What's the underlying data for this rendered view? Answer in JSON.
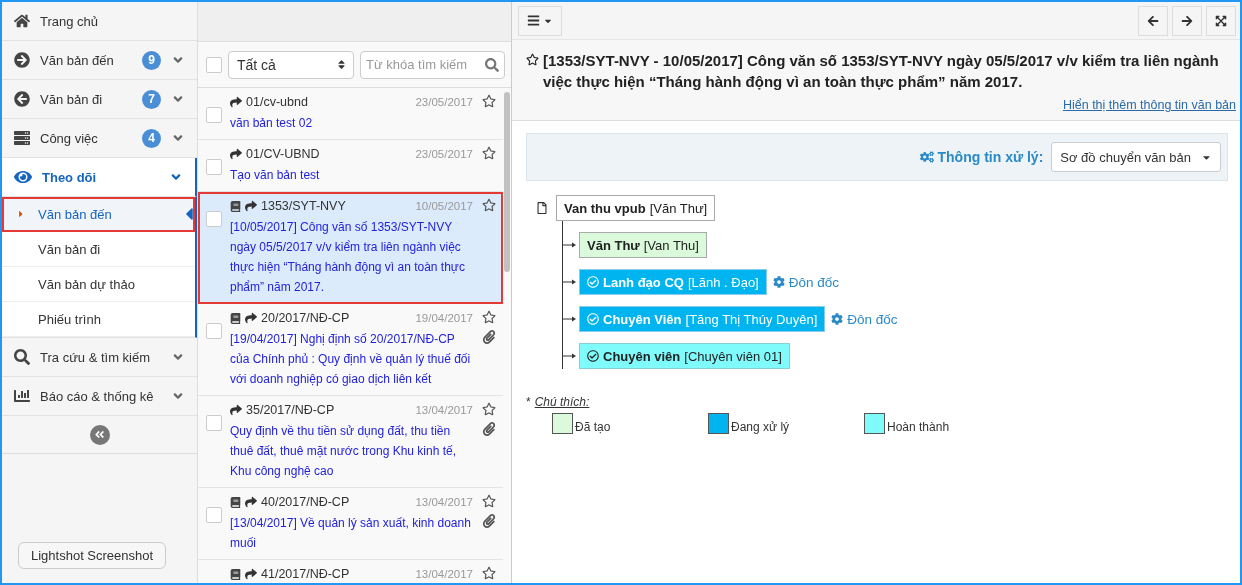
{
  "sidebar": {
    "items": [
      {
        "label": "Trang chủ",
        "submenu": false,
        "selected": false
      },
      {
        "label": "Văn bản đến",
        "badge": "9",
        "submenu": true,
        "selected": false
      },
      {
        "label": "Văn bản đi",
        "badge": "7",
        "submenu": true,
        "selected": false
      },
      {
        "label": "Công việc",
        "badge": "4",
        "submenu": true,
        "selected": false
      },
      {
        "label": "Theo dõi",
        "submenu": true,
        "selected": true,
        "children": [
          {
            "label": "Văn bản đến",
            "selected": true
          },
          {
            "label": "Văn bản đi",
            "selected": false
          },
          {
            "label": "Văn bản dự thảo",
            "selected": false
          },
          {
            "label": "Phiếu trình",
            "selected": false
          }
        ]
      },
      {
        "label": "Tra cứu & tìm kiếm",
        "submenu": true,
        "selected": false
      },
      {
        "label": "Báo cáo & thống kê",
        "submenu": true,
        "selected": false
      }
    ]
  },
  "tooltip": "Lightshot Screenshot",
  "list": {
    "select_all": {
      "checked": false
    },
    "filter": "Tất cả",
    "search": {
      "placeholder": "Từ khóa tìm kiếm"
    },
    "items": [
      {
        "number": "01/cv-ubnd",
        "date": "23/05/2017",
        "summary": "văn bản test 02",
        "book": false,
        "attachment": false,
        "checked": false,
        "selected": false
      },
      {
        "number": "01/CV-UBND",
        "date": "23/05/2017",
        "summary": "Tạo văn bản test",
        "book": false,
        "attachment": false,
        "checked": false,
        "selected": false
      },
      {
        "number": "1353/SYT-NVY",
        "date": "10/05/2017",
        "summary": "[10/05/2017] Công văn số 1353/SYT-NVY ngày 05/5/2017 v/v kiểm tra liên ngành việc thực hiện “Tháng hành động vì an toàn thực phẩm” năm 2017.",
        "book": true,
        "attachment": false,
        "checked": false,
        "selected": true
      },
      {
        "number": "20/2017/NĐ-CP",
        "date": "19/04/2017",
        "summary": "[19/04/2017] Nghị định số 20/2017/NĐ-CP của Chính phủ : Quy định về quản lý thuế đối với doanh nghiệp có giao dịch liên kết",
        "book": true,
        "attachment": true,
        "checked": false,
        "selected": false
      },
      {
        "number": "35/2017/NĐ-CP",
        "date": "13/04/2017",
        "summary": "Quy định về thu tiền sử dụng đất, thu tiền thuê đất, thuê mặt nước trong Khu kinh tế, Khu công nghệ cao",
        "book": false,
        "attachment": true,
        "checked": false,
        "selected": false
      },
      {
        "number": "40/2017/NĐ-CP",
        "date": "13/04/2017",
        "summary": "[13/04/2017] Về quản lý sản xuất, kinh doanh muối",
        "book": true,
        "attachment": true,
        "checked": false,
        "selected": false
      },
      {
        "number": "41/2017/NĐ-CP",
        "date": "13/04/2017",
        "book": true,
        "attachment": false,
        "selected": false
      }
    ]
  },
  "detail": {
    "title": "[1353/SYT-NVY - 10/05/2017] Công văn số 1353/SYT-NVY ngày 05/5/2017 v/v kiểm tra liên ngành việc thực hiện “Tháng hành động vì an toàn thực phẩm” năm 2017.",
    "more_link": "Hiển thị thêm thông tin văn bản",
    "processing_label": "Thông tin xử lý:",
    "view": "Sơ đồ chuyển văn bản",
    "tree": {
      "name": "Van thu vpub",
      "role": "[Văn Thư]",
      "children": [
        {
          "name": "Văn Thư",
          "role": "[Van Thu]",
          "kind": "created"
        },
        {
          "name": "Lanh đạo CQ",
          "role": "[Lãnh . Đạo]",
          "kind": "processing",
          "action": "Đôn đốc"
        },
        {
          "name": "Chuyên Viên",
          "role": "[Tăng Thị Thúy Duyên]",
          "kind": "processing",
          "action": "Đôn đốc"
        },
        {
          "name": "Chuyên viên",
          "role": "[Chuyên viên 01]",
          "kind": "done"
        }
      ]
    },
    "legend_marker": "*",
    "legend_title": "Chú thích:",
    "legend": [
      {
        "label": "Đã tạo",
        "color": "#dbfadb"
      },
      {
        "label": "Đang xử lý",
        "color": "#00b5ef"
      },
      {
        "label": "Hoàn thành",
        "color": "#80fbfb"
      }
    ]
  }
}
